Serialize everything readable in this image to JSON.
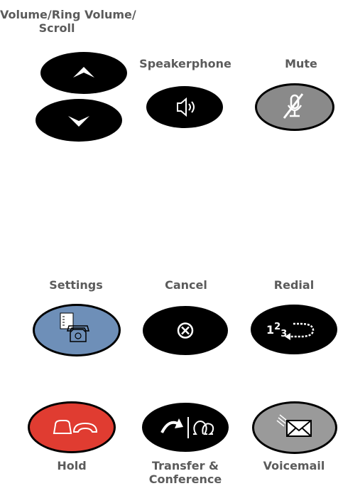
{
  "labels": {
    "volume_line1": "Volume/Ring Volume/",
    "volume_line2": "Scroll",
    "speakerphone": "Speakerphone",
    "mute": "Mute",
    "settings": "Settings",
    "cancel": "Cancel",
    "redial": "Redial",
    "hold": "Hold",
    "transfer_line1": "Transfer &",
    "transfer_line2": "Conference",
    "voicemail": "Voicemail"
  },
  "redial_text": "123",
  "colors": {
    "label": "#5b5b5b",
    "key_black": "#000000",
    "mute_fill": "#8a8a8a",
    "settings_fill": "#6e8fb8",
    "hold_fill": "#e03c31",
    "voicemail_fill": "#9a9a9a",
    "icon_white": "#ffffff"
  },
  "icons": {
    "volume_up": "chevron-up-icon",
    "volume_down": "chevron-down-icon",
    "speakerphone": "speaker-icon",
    "mute": "muted-microphone-icon",
    "settings": "settings-phone-icon",
    "cancel": "cancel-x-icon",
    "redial": "redial-arrow-icon",
    "hold": "hold-phone-icon",
    "transfer": "transfer-conference-icon",
    "voicemail": "voicemail-envelope-icon"
  }
}
